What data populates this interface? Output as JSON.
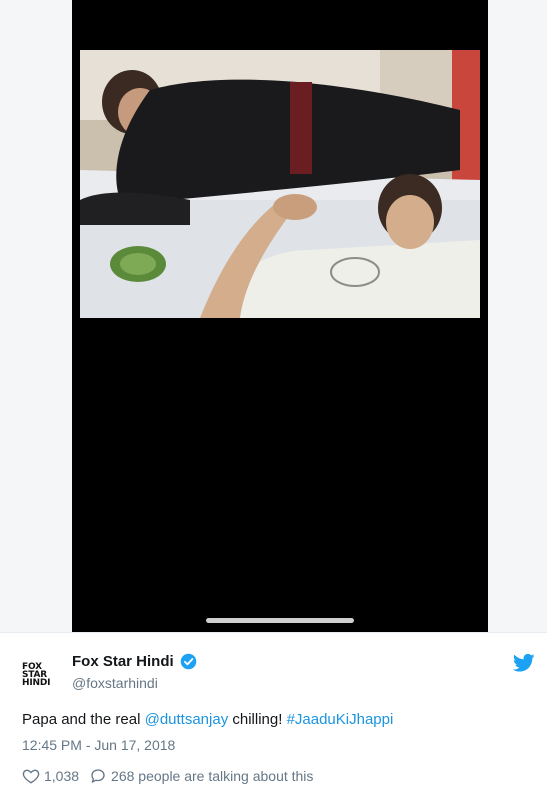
{
  "media": {
    "alt": ""
  },
  "author": {
    "display_name": "Fox Star Hindi",
    "handle": "@foxstarhindi",
    "logo_lines": [
      "FOX",
      "STAR",
      "HINDI"
    ],
    "verified": true
  },
  "tweet": {
    "text_before": "Papa and the real ",
    "mention": "@duttsanjay",
    "text_middle": " chilling! ",
    "hashtag": "#JaaduKiJhappi",
    "timestamp": "12:45 PM - Jun 17, 2018"
  },
  "engagement": {
    "likes": "1,038",
    "conversation": "268 people are talking about this"
  },
  "icons": {
    "verified": "verified-badge-icon",
    "bird": "twitter-bird-icon",
    "heart": "heart-icon",
    "reply": "speech-bubble-icon"
  },
  "colors": {
    "link": "#1b95e0",
    "secondary_text": "#657786",
    "frame": "#000000"
  }
}
